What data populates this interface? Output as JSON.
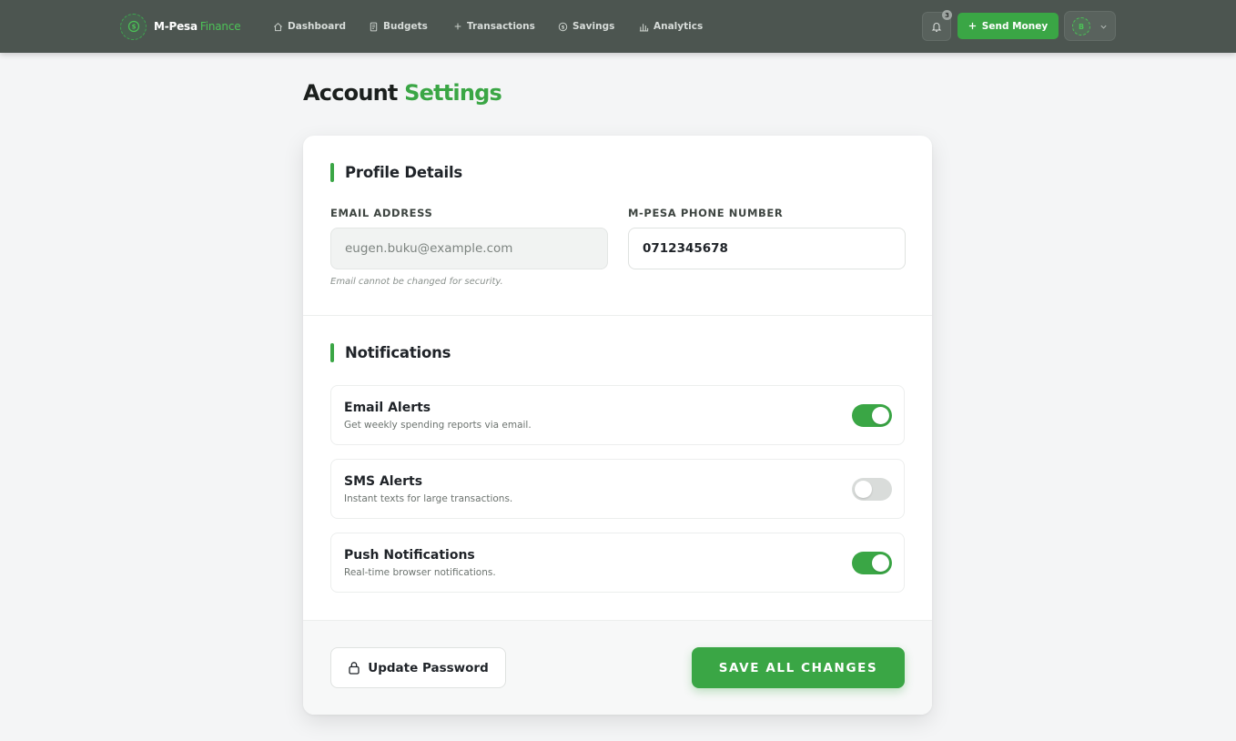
{
  "colors": {
    "accent": "#3aa645",
    "navbar": "#4c5550",
    "toggle_off": "#d9dcda"
  },
  "nav": {
    "brand_name": "M-Pesa",
    "brand_accent": "Finance",
    "brand_icon": "dollar-circle-icon",
    "links": [
      {
        "label": "Dashboard",
        "icon": "home-icon"
      },
      {
        "label": "Budgets",
        "icon": "document-icon"
      },
      {
        "label": "Transactions",
        "icon": "plus-icon"
      },
      {
        "label": "Savings",
        "icon": "coin-icon"
      },
      {
        "label": "Analytics",
        "icon": "bar-chart-icon"
      }
    ],
    "notification_count": "3",
    "send_money_label": "Send Money",
    "avatar_initial": "B"
  },
  "page": {
    "title_main": "Account",
    "title_accent": "Settings"
  },
  "profile": {
    "heading": "Profile Details",
    "email_label": "EMAIL ADDRESS",
    "email_value": "eugen.buku@example.com",
    "email_hint": "Email cannot be changed for security.",
    "phone_label": "M-PESA PHONE NUMBER",
    "phone_value": "0712345678"
  },
  "notifications": {
    "heading": "Notifications",
    "items": [
      {
        "title": "Email Alerts",
        "description": "Get weekly spending reports via email.",
        "enabled": true
      },
      {
        "title": "SMS Alerts",
        "description": "Instant texts for large transactions.",
        "enabled": false
      },
      {
        "title": "Push Notifications",
        "description": "Real-time browser notifications.",
        "enabled": true
      }
    ]
  },
  "actions": {
    "update_password_label": "Update Password",
    "save_label": "SAVE ALL CHANGES"
  }
}
